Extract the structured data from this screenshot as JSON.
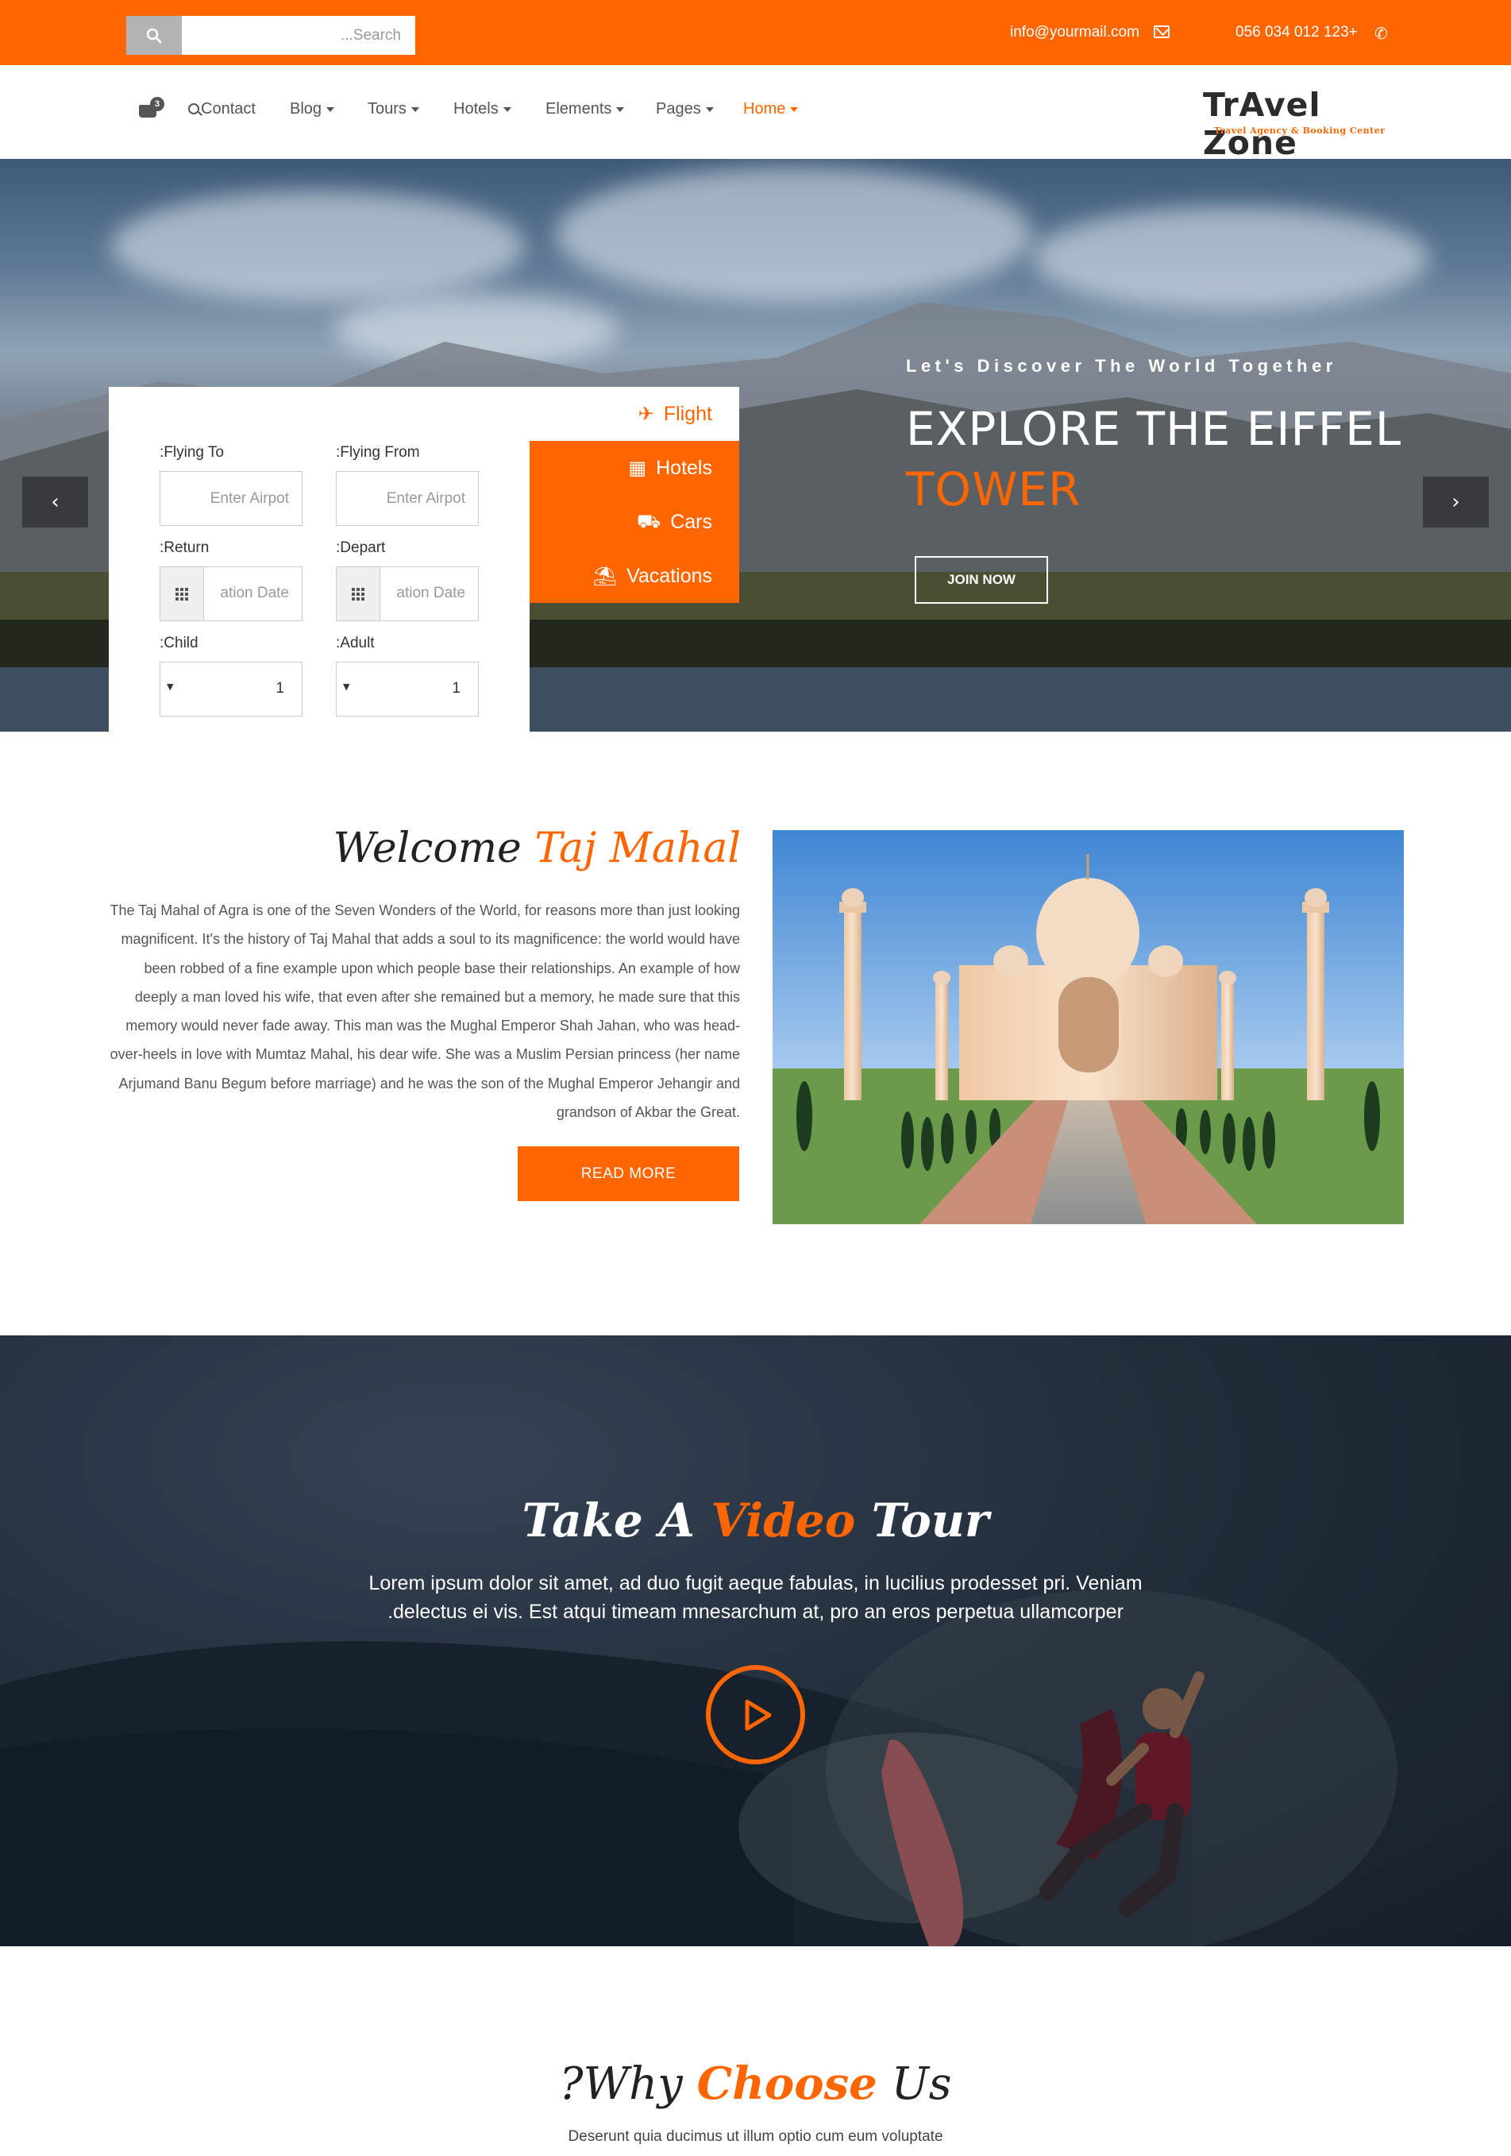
{
  "topbar": {
    "search_placeholder": "...Search",
    "email": "info@yourmail.com",
    "phone": "056 034 012 123+"
  },
  "nav": {
    "cart_count": "3",
    "items": [
      {
        "label": "Contact",
        "has_caret": false
      },
      {
        "label": "Blog",
        "has_caret": true
      },
      {
        "label": "Tours",
        "has_caret": true
      },
      {
        "label": "Hotels",
        "has_caret": true
      },
      {
        "label": "Elements",
        "has_caret": true
      },
      {
        "label": "Pages",
        "has_caret": true
      },
      {
        "label": "Home",
        "has_caret": true,
        "active": true
      }
    ],
    "logo_text": "TrAvel Zone",
    "logo_tagline": "Travel Agency & Booking Center"
  },
  "hero": {
    "tagline": "Let's Discover The World Together",
    "title_line1": "EXPLORE THE EIFFEL",
    "title_line2": "TOWER",
    "join_label": "JOIN NOW",
    "prev_arrow": "‹",
    "next_arrow": "›"
  },
  "booking": {
    "flying_to_label": ":Flying To",
    "flying_to_placeholder": "Enter Airpot",
    "flying_from_label": ":Flying From",
    "flying_from_placeholder": "Enter Airpot",
    "return_label": ":Return",
    "return_placeholder": "ation Date",
    "depart_label": ":Depart",
    "depart_placeholder": "ation Date",
    "child_label": ":Child",
    "child_value": "1",
    "adult_label": ":Adult",
    "adult_value": "1",
    "tabs": [
      {
        "label": "Flight",
        "icon": "plane-icon",
        "active": true
      },
      {
        "label": "Hotels",
        "icon": "building-icon"
      },
      {
        "label": "Cars",
        "icon": "car-icon"
      },
      {
        "label": "Vacations",
        "icon": "beach-icon"
      }
    ]
  },
  "welcome": {
    "title_plain": "Welcome",
    "title_highlight": "Taj Mahal",
    "text": "The Taj Mahal of Agra is one of the Seven Wonders of the World, for reasons more than just looking magnificent. It's the history of Taj Mahal that adds a soul to its magnificence: the world would have been robbed of a fine example upon which people base their relationships. An example of how deeply a man loved his wife, that even after she remained but a memory, he made sure that this memory would never fade away. This man was the Mughal Emperor Shah Jahan, who was head-over-heels in love with Mumtaz Mahal, his dear wife. She was a Muslim Persian princess (her name Arjumand Banu Begum before marriage) and he was the son of the Mughal Emperor Jehangir and grandson of Akbar the Great.",
    "read_more_label": "READ MORE"
  },
  "video": {
    "title_part1": "Take A",
    "title_highlight": "Video",
    "title_part2": "Tour",
    "text": "Lorem ipsum dolor sit amet, ad duo fugit aeque fabulas, in lucilius prodesset pri. Veniam .delectus ei vis. Est atqui timeam mnesarchum at, pro an eros perpetua ullamcorper"
  },
  "why": {
    "title_part1": "?Why",
    "title_highlight": "Choose",
    "title_part2": "Us",
    "subtitle": "Deserunt quia ducimus ut illum optio cum eum voluptate"
  },
  "colors": {
    "accent": "#ff6600",
    "search_button": "#b3b3b3",
    "text_dark": "#333333"
  }
}
